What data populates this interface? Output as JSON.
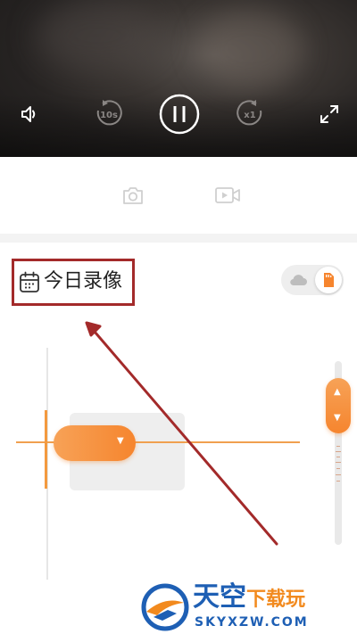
{
  "player": {
    "controls": [
      {
        "name": "volume-icon"
      },
      {
        "name": "rewind-10s-icon",
        "label": "10s"
      },
      {
        "name": "pause-icon"
      },
      {
        "name": "playback-speed-icon",
        "label": "x1"
      },
      {
        "name": "fullscreen-icon"
      }
    ]
  },
  "tools": [
    {
      "name": "screenshot-camera-icon"
    },
    {
      "name": "record-video-icon"
    }
  ],
  "today_recording": {
    "label": "今日录像",
    "icon": "calendar-icon"
  },
  "storage_toggle": {
    "options": [
      "cloud-icon",
      "sd-card-icon"
    ],
    "selected": "sd-card-icon"
  },
  "timeline": {
    "handle_icon": "caret-down-icon",
    "zoom_icons": [
      "caret-up-icon",
      "caret-down-icon"
    ]
  },
  "colors": {
    "accent": "#f6852e",
    "annotation": "#a32a2a",
    "watermark_blue": "#1e5fb4",
    "watermark_orange": "#f28a1e"
  },
  "watermark": {
    "cn_main": "天空",
    "cn_sub": "下载玩",
    "en": "SKYXZW.COM"
  }
}
